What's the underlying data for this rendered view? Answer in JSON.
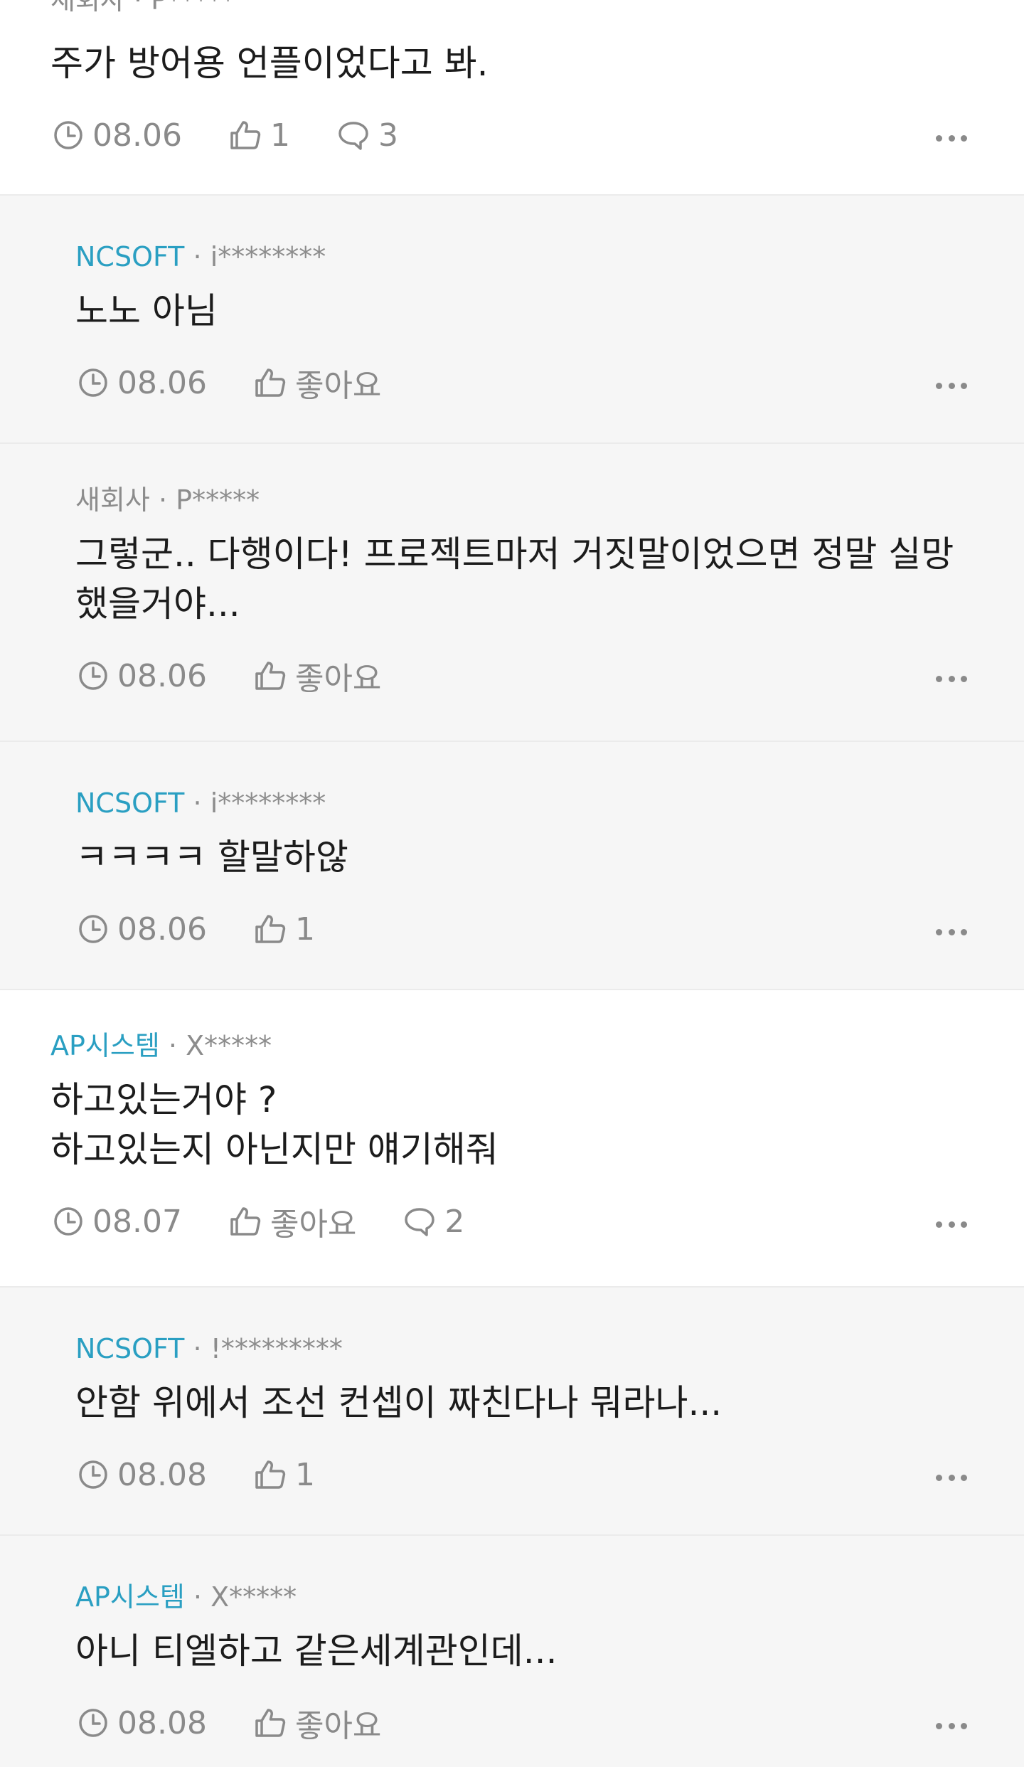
{
  "comments": [
    {
      "company": "새회사",
      "user": "P*****",
      "sep": "·",
      "text": "주가 방어용 언플이었다고 봐.",
      "date": "08.06",
      "likes": "1",
      "replies": "3"
    },
    {
      "company": "NCSOFT",
      "user": "i********",
      "sep": "·",
      "text": "노노 아님",
      "date": "08.06",
      "likes": "좋아요"
    },
    {
      "company": "새회사",
      "user": "P*****",
      "sep": "·",
      "text": "그렇군.. 다행이다! 프로젝트마저 거짓말이었으면 정말 실망했을거야...",
      "date": "08.06",
      "likes": "좋아요"
    },
    {
      "company": "NCSOFT",
      "user": "i********",
      "sep": "·",
      "text": "ㅋㅋㅋㅋ 할말하않",
      "date": "08.06",
      "likes": "1"
    },
    {
      "company": "AP시스템",
      "user": "X*****",
      "sep": "·",
      "text": "하고있는거야 ?\n하고있는지 아닌지만 얘기해줘",
      "date": "08.07",
      "likes": "좋아요",
      "replies": "2"
    },
    {
      "company": "NCSOFT",
      "user": "!*********",
      "sep": "·",
      "text": "안함 위에서 조선 컨셉이 짜친다나 뭐라나...",
      "date": "08.08",
      "likes": "1"
    },
    {
      "company": "AP시스템",
      "user": "X*****",
      "sep": "·",
      "text": "아니 티엘하고 같은세계관인데...",
      "date": "08.08",
      "likes": "좋아요"
    }
  ]
}
